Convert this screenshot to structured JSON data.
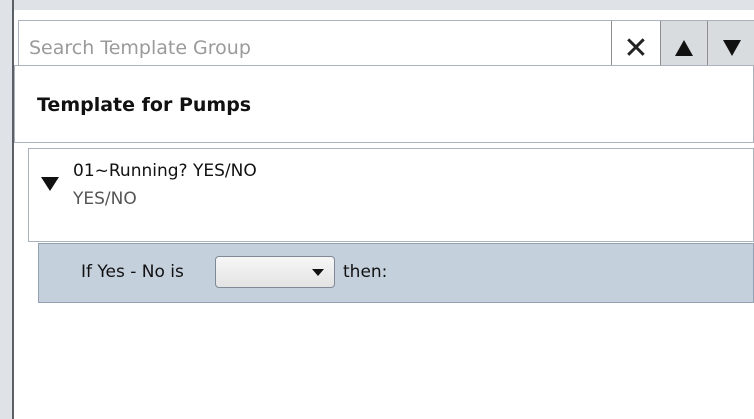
{
  "search": {
    "placeholder": "Search Template Group",
    "value": "",
    "clear_icon": "close-icon",
    "up_icon": "triangle-up-icon",
    "down_icon": "triangle-down-icon"
  },
  "template": {
    "title": "Template for Pumps"
  },
  "question": {
    "title": "01~Running? YES/NO",
    "subtitle": "YES/NO",
    "expand_icon": "triangle-down-icon"
  },
  "condition": {
    "prefix": "If Yes - No is",
    "selected_value": "",
    "suffix": "then:"
  },
  "colors": {
    "condition_bg": "#c5d0dd",
    "button_bg": "#d9dcdf",
    "border": "#a9b2bd"
  }
}
